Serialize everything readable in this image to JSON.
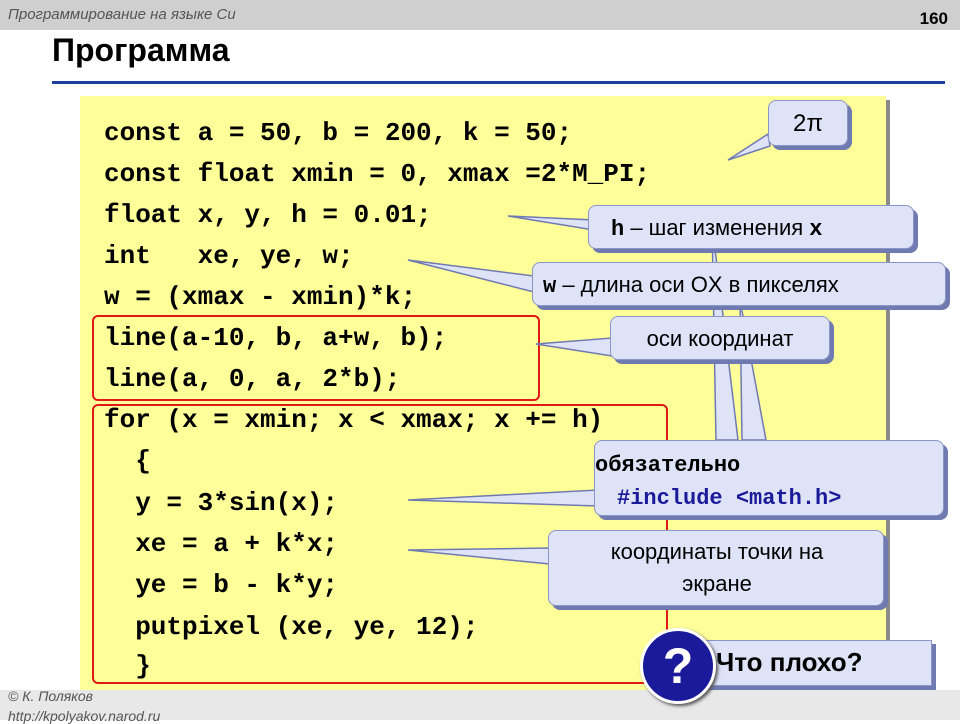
{
  "header": {
    "subject": "Программирование на языке Си",
    "page": "160"
  },
  "title": "Программа",
  "code": [
    "const a = 50, b = 200, k = 50;",
    "const float xmin = 0, xmax =2*M_PI;",
    "float x, y, h = 0.01;",
    "int   xe, ye, w;",
    "w = (xmax - xmin)*k;",
    "line(a-10, b, a+w, b);",
    "line(a, 0, a, 2*b);",
    "for (x = xmin; x < xmax; x += h)",
    "  {",
    "  y = 3*sin(x);",
    "  xe = a + k*x;",
    "  ye = b - k*y;",
    "  putpixel (xe, ye, 12);",
    "  }"
  ],
  "callouts": {
    "two_pi": "2π",
    "h_var": "h",
    "h_text": " – шаг изменения ",
    "h_x": "x",
    "w_var": "w",
    "w_text": " – длина оси OX в пикселях",
    "axes": "оси координат",
    "must_title": "обязательно",
    "must_include": "#include <math.h>",
    "coords_line1": "координаты точки на",
    "coords_line2": "экране"
  },
  "question": {
    "icon": "?",
    "text": "Что плохо?"
  },
  "footer": {
    "author": "© К. Поляков",
    "url": "http://kpolyakov.narod.ru"
  },
  "colors": {
    "code_bg": "#ffff99",
    "callout_bg": "#dfe3f7",
    "rule": "#1f3f9f",
    "highlight_box": "#e01818",
    "question_icon": "#1a1a9a"
  }
}
